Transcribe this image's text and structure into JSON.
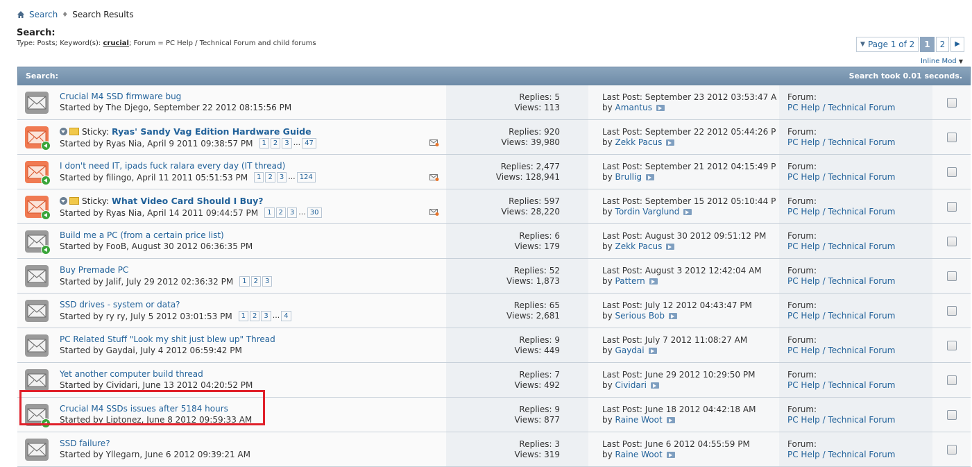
{
  "breadcrumb": {
    "home_icon": "home-icon",
    "search": "Search",
    "current": "Search Results"
  },
  "page_title": "Search:",
  "search_desc": {
    "prefix": "Type: Posts; Keyword(s): ",
    "keyword": "crucial",
    "suffix": "; Forum = PC Help / Technical Forum and child forums"
  },
  "pagenav": {
    "page_of": "Page 1 of 2",
    "pages": [
      "1",
      "2"
    ],
    "current": "1",
    "next_icon": "arrow-right-icon"
  },
  "inline_mod": "Inline Mod",
  "header": {
    "left": "Search:",
    "right": "Search took 0.01 seconds."
  },
  "highlight_color": "#e0202a",
  "rows": [
    {
      "icon": "gray",
      "go": false,
      "sticky": false,
      "title": "Crucial M4 SSD firmware bug",
      "starter": "Started by The Djego, September 22 2012 08:15:56 PM",
      "pages": [],
      "mail": false,
      "replies": "Replies: 5",
      "views": "Views: 113",
      "last_post": "Last Post: September 23 2012 03:53:47 A",
      "last_by": "Amantus",
      "forum_label": "Forum:",
      "forum": "PC Help / Technical Forum"
    },
    {
      "icon": "orange",
      "go": true,
      "sticky": true,
      "sticky_label": "Sticky:",
      "title": "Ryas' Sandy Vag Edition Hardware Guide",
      "starter": "Started by Ryas Nia, April 9 2011 09:38:57 PM",
      "pages": [
        "1",
        "2",
        "3",
        "...",
        "47"
      ],
      "mail": true,
      "replies": "Replies: 920",
      "views": "Views: 39,980",
      "last_post": "Last Post: September 22 2012 05:44:26 P",
      "last_by": "Zekk Pacus",
      "forum_label": "Forum:",
      "forum": "PC Help / Technical Forum"
    },
    {
      "icon": "orange",
      "go": true,
      "sticky": false,
      "title": "I don't need IT, ipads fuck ralara every day (IT thread)",
      "starter": "Started by filingo, April 11 2011 05:51:53 PM",
      "pages": [
        "1",
        "2",
        "3",
        "...",
        "124"
      ],
      "mail": true,
      "replies": "Replies: 2,477",
      "views": "Views: 128,941",
      "last_post": "Last Post: September 21 2012 04:15:49 P",
      "last_by": "Brullig",
      "forum_label": "Forum:",
      "forum": "PC Help / Technical Forum"
    },
    {
      "icon": "orange",
      "go": true,
      "sticky": true,
      "sticky_label": "Sticky:",
      "title": "What Video Card Should I Buy?",
      "starter": "Started by Ryas Nia, April 14 2011 09:44:57 PM",
      "pages": [
        "1",
        "2",
        "3",
        "...",
        "30"
      ],
      "mail": true,
      "replies": "Replies: 597",
      "views": "Views: 28,220",
      "last_post": "Last Post: September 15 2012 05:10:44 P",
      "last_by": "Tordin Varglund",
      "forum_label": "Forum:",
      "forum": "PC Help / Technical Forum"
    },
    {
      "icon": "gray",
      "go": true,
      "sticky": false,
      "title": "Build me a PC (from a certain price list)",
      "starter": "Started by FooB, August 30 2012 06:36:35 PM",
      "pages": [],
      "mail": false,
      "replies": "Replies: 6",
      "views": "Views: 179",
      "last_post": "Last Post: August 30 2012 09:51:12 PM",
      "last_by": "Zekk Pacus",
      "forum_label": "Forum:",
      "forum": "PC Help / Technical Forum"
    },
    {
      "icon": "gray",
      "go": false,
      "sticky": false,
      "title": "Buy Premade PC",
      "starter": "Started by Jalif, July 29 2012 02:36:32 PM",
      "pages": [
        "1",
        "2",
        "3"
      ],
      "mail": false,
      "replies": "Replies: 52",
      "views": "Views: 1,873",
      "last_post": "Last Post: August 3 2012 12:42:04 AM",
      "last_by": "Pattern",
      "forum_label": "Forum:",
      "forum": "PC Help / Technical Forum"
    },
    {
      "icon": "gray",
      "go": false,
      "sticky": false,
      "title": "SSD drives - system or data?",
      "starter": "Started by ry ry, July 5 2012 03:01:53 PM",
      "pages": [
        "1",
        "2",
        "3",
        "...",
        "4"
      ],
      "mail": false,
      "replies": "Replies: 65",
      "views": "Views: 2,681",
      "last_post": "Last Post: July 12 2012 04:43:47 PM",
      "last_by": "Serious Bob",
      "forum_label": "Forum:",
      "forum": "PC Help / Technical Forum"
    },
    {
      "icon": "gray",
      "go": false,
      "sticky": false,
      "title": "PC Related Stuff \"Look my shit just blew up\" Thread",
      "starter": "Started by Gaydai, July 4 2012 06:59:42 PM",
      "pages": [],
      "mail": false,
      "replies": "Replies: 9",
      "views": "Views: 449",
      "last_post": "Last Post: July 7 2012 11:08:27 AM",
      "last_by": "Gaydai",
      "forum_label": "Forum:",
      "forum": "PC Help / Technical Forum"
    },
    {
      "icon": "gray",
      "go": false,
      "sticky": false,
      "title": "Yet another computer build thread",
      "starter": "Started by Cividari, June 13 2012 04:20:52 PM",
      "pages": [],
      "mail": false,
      "replies": "Replies: 7",
      "views": "Views: 492",
      "last_post": "Last Post: June 29 2012 10:29:50 PM",
      "last_by": "Cividari",
      "forum_label": "Forum:",
      "forum": "PC Help / Technical Forum"
    },
    {
      "icon": "gray",
      "go": true,
      "sticky": false,
      "title": "Crucial M4 SSDs issues after 5184 hours",
      "starter": "Started by Liptonez, June 8 2012 09:59:33 AM",
      "pages": [],
      "mail": false,
      "replies": "Replies: 9",
      "views": "Views: 877",
      "last_post": "Last Post: June 18 2012 04:42:18 AM",
      "last_by": "Raine Woot",
      "forum_label": "Forum:",
      "forum": "PC Help / Technical Forum"
    },
    {
      "icon": "gray",
      "go": false,
      "sticky": false,
      "title": "SSD failure?",
      "starter": "Started by Yllegarn, June 6 2012 09:39:21 AM",
      "pages": [],
      "mail": false,
      "replies": "Replies: 3",
      "views": "Views: 319",
      "last_post": "Last Post: June 6 2012 04:55:59 PM",
      "last_by": "Raine Woot",
      "forum_label": "Forum:",
      "forum": "PC Help / Technical Forum"
    }
  ]
}
